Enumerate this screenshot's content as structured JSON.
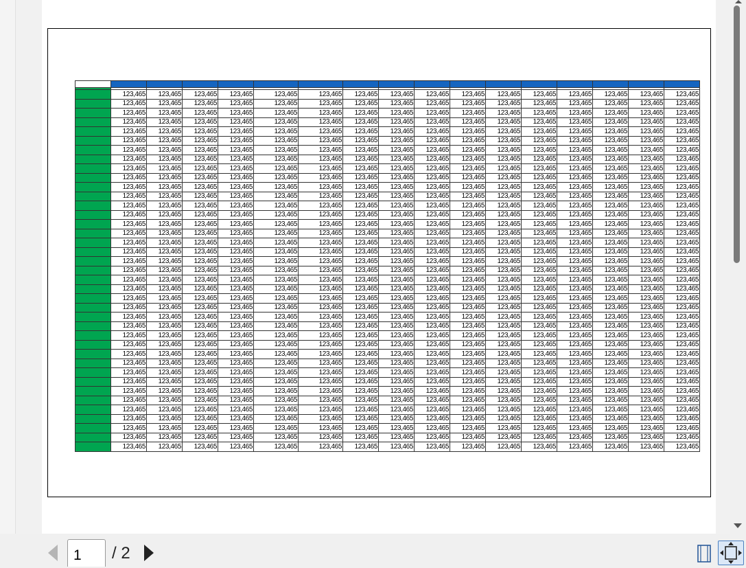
{
  "viewer": {
    "current_page": "1",
    "total_pages": "/ 2",
    "icons": {
      "prev": "triangle-left-icon",
      "next": "triangle-right-icon",
      "fit_page": "fit-page-icon",
      "fit_width": "fit-width-icon"
    }
  },
  "sheet": {
    "cell_value": "123,465",
    "data_columns": 16,
    "data_rows": 39,
    "colors": {
      "header": "#1565c0",
      "row_header": "#00a550",
      "grid": "#333333"
    }
  }
}
